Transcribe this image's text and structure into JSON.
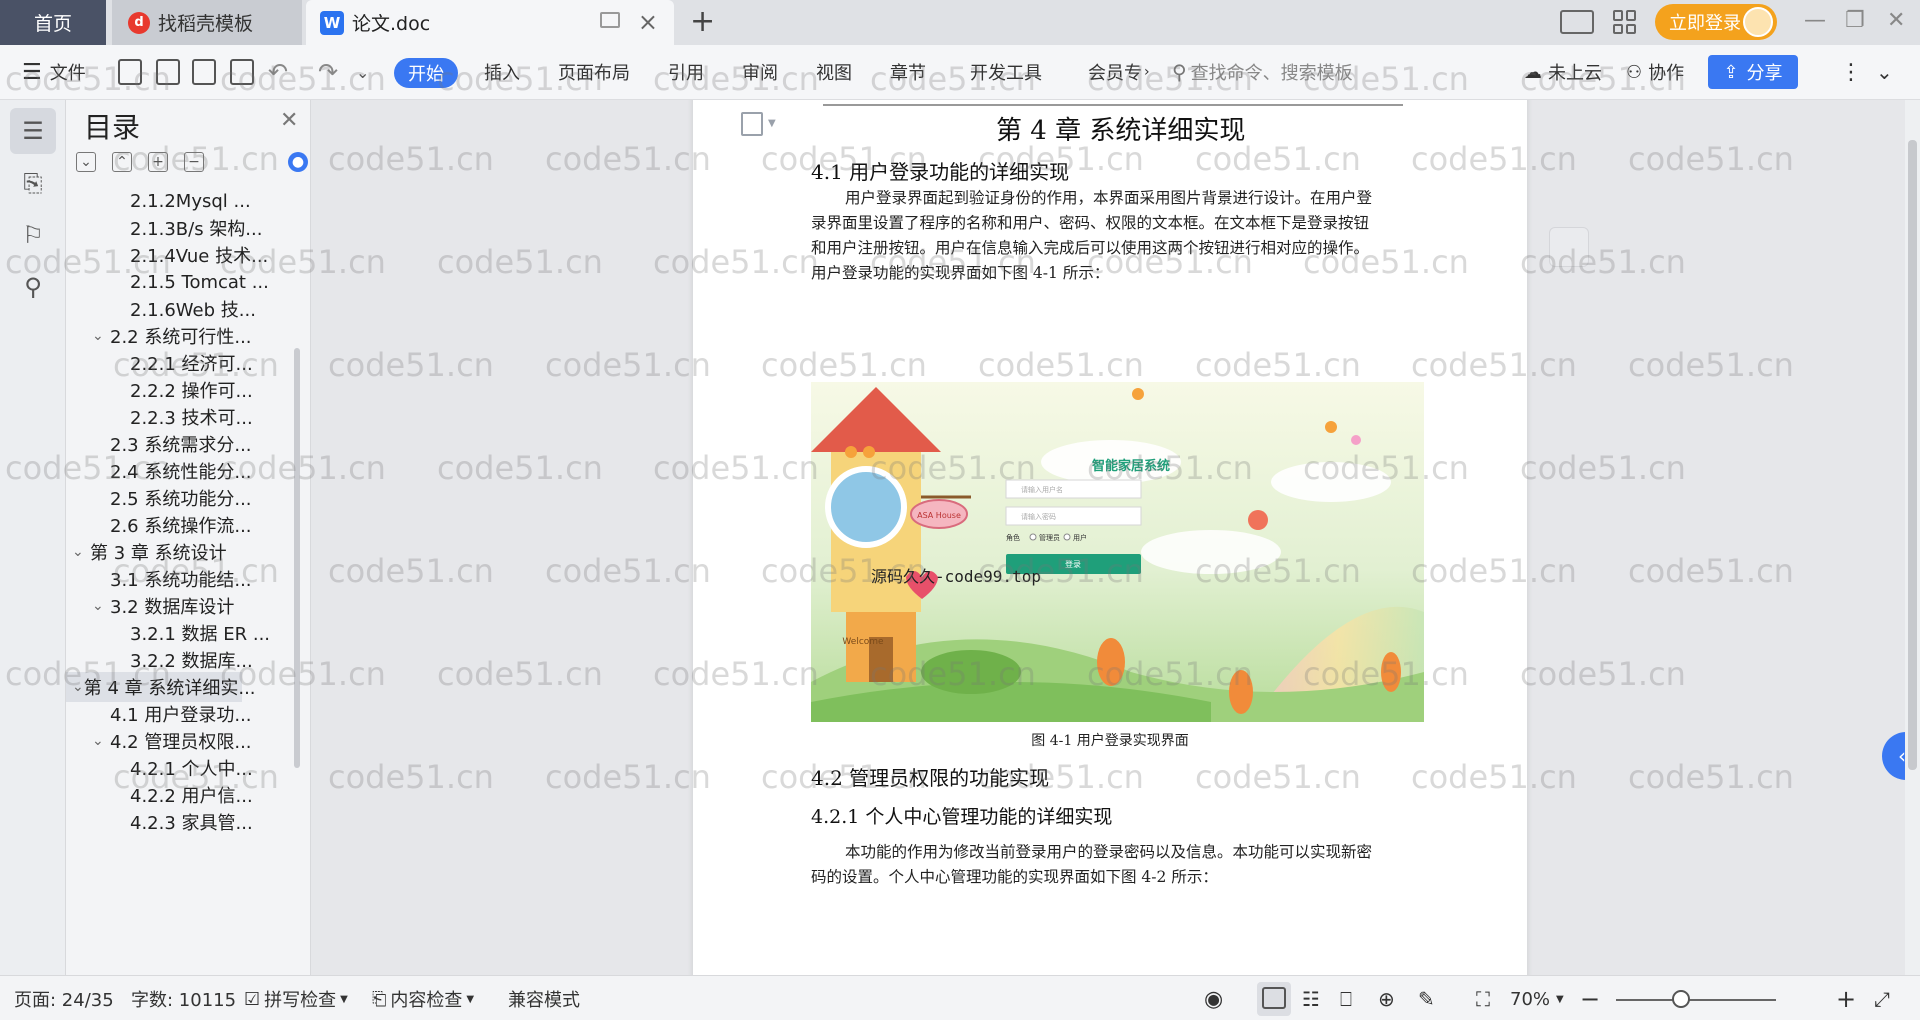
{
  "tabs": {
    "home": "首页",
    "templates": "找稻壳模板",
    "document": "论文.doc"
  },
  "titlebar": {
    "login": "立即登录"
  },
  "ribbon": {
    "file": "文件",
    "start": "开始",
    "insert": "插入",
    "page_layout": "页面布局",
    "references": "引用",
    "review": "审阅",
    "view": "视图",
    "chapter": "章节",
    "dev_tools": "开发工具",
    "member": "会员专",
    "search_placeholder": "查找命令、搜索模板",
    "cloud": "未上云",
    "collab": "协作",
    "share": "分享"
  },
  "toc": {
    "title": "目录",
    "items": [
      {
        "label": "2.1.2Mysql ...",
        "level": 3
      },
      {
        "label": "2.1.3B/s 架构...",
        "level": 3
      },
      {
        "label": "2.1.4Vue 技术...",
        "level": 3
      },
      {
        "label": "2.1.5 Tomcat ...",
        "level": 3
      },
      {
        "label": "2.1.6Web 技...",
        "level": 3
      },
      {
        "label": "2.2 系统可行性...",
        "level": 2,
        "expanded": true
      },
      {
        "label": "2.2.1 经济可...",
        "level": 3
      },
      {
        "label": "2.2.2 操作可...",
        "level": 3
      },
      {
        "label": "2.2.3 技术可...",
        "level": 3
      },
      {
        "label": "2.3 系统需求分...",
        "level": 2
      },
      {
        "label": "2.4 系统性能分...",
        "level": 2
      },
      {
        "label": "2.5 系统功能分...",
        "level": 2
      },
      {
        "label": "2.6 系统操作流...",
        "level": 2
      },
      {
        "label": "第 3 章  系统设计",
        "level": 1,
        "expanded": true
      },
      {
        "label": "3.1 系统功能结...",
        "level": 2
      },
      {
        "label": "3.2 数据库设计",
        "level": 2,
        "expanded": true
      },
      {
        "label": "3.2.1 数据 ER ...",
        "level": 3
      },
      {
        "label": "3.2.2 数据库...",
        "level": 3
      },
      {
        "label": "第 4 章  系统详细实...",
        "level": 1,
        "expanded": true,
        "selected": true
      },
      {
        "label": "4.1 用户登录功...",
        "level": 2
      },
      {
        "label": "4.2 管理员权限...",
        "level": 2,
        "expanded": true
      },
      {
        "label": "4.2.1 个人中...",
        "level": 3
      },
      {
        "label": "4.2.2 用户信...",
        "level": 3
      },
      {
        "label": "4.2.3 家具管...",
        "level": 3
      }
    ]
  },
  "document": {
    "chapter_title": "第 4 章  系统详细实现",
    "section_41": "4.1 用户登录功能的详细实现",
    "para_41_lines": [
      "用户登录界面起到验证身份的作用，本界面采用图片背景进行设计。在用户登",
      "录界面里设置了程序的名称和用户、密码、权限的文本框。在文本框下是登录按钮",
      "和用户注册按钮。用户在信息输入完成后可以使用这两个按钮进行相对应的操作。",
      "用户登录功能的实现界面如下图 4-1 所示："
    ],
    "figure": {
      "system_name": "智能家居系统",
      "user_placeholder": "请输入用户名",
      "password_placeholder": "请输入密码",
      "role_label": "角色",
      "role_admin": "管理员",
      "role_user": "用户",
      "login_button": "登录",
      "house_sign": "ASA House",
      "welcome": "Welcome",
      "overlay_text": "源码久久-code99.top"
    },
    "figure_caption": "图 4-1 用户登录实现界面",
    "section_42": "4.2 管理员权限的功能实现",
    "section_421": "4.2.1 个人中心管理功能的详细实现",
    "para_421_lines": [
      "本功能的作用为修改当前登录用户的登录密码以及信息。本功能可以实现新密",
      "码的设置。个人中心管理功能的实现界面如下图 4-2 所示："
    ]
  },
  "watermark": "code51.cn",
  "statusbar": {
    "page": "页面: 24/35",
    "words": "字数: 10115",
    "spell_check": "拼写检查",
    "content_check": "内容检查",
    "compat_mode": "兼容模式",
    "zoom": "70%"
  }
}
